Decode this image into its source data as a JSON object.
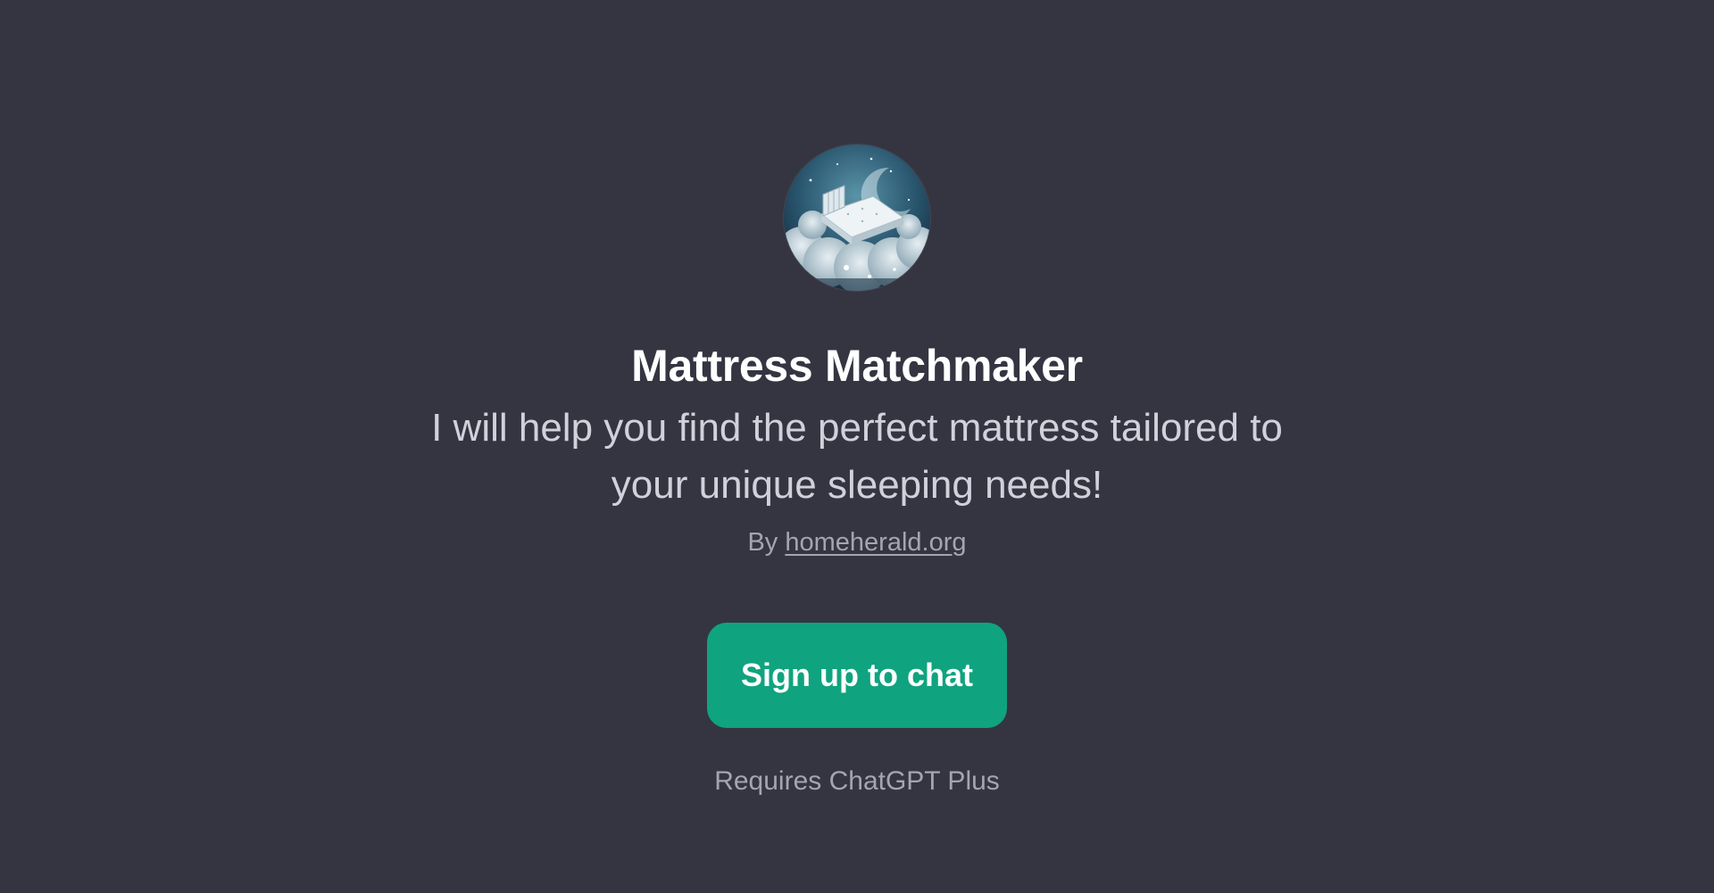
{
  "gpt": {
    "name": "Mattress Matchmaker",
    "description": "I will help you find the perfect mattress tailored to your unique sleeping needs!",
    "by_prefix": "By",
    "author_link": "homeherald.org",
    "avatar_icon": "mattress-on-clouds-avatar"
  },
  "cta": {
    "label": "Sign up to chat"
  },
  "footer": {
    "requires": "Requires ChatGPT Plus"
  },
  "colors": {
    "background": "#343541",
    "accent": "#10a37f",
    "title": "#ffffff",
    "description": "#d1d1db",
    "muted": "#a5a5b0"
  }
}
